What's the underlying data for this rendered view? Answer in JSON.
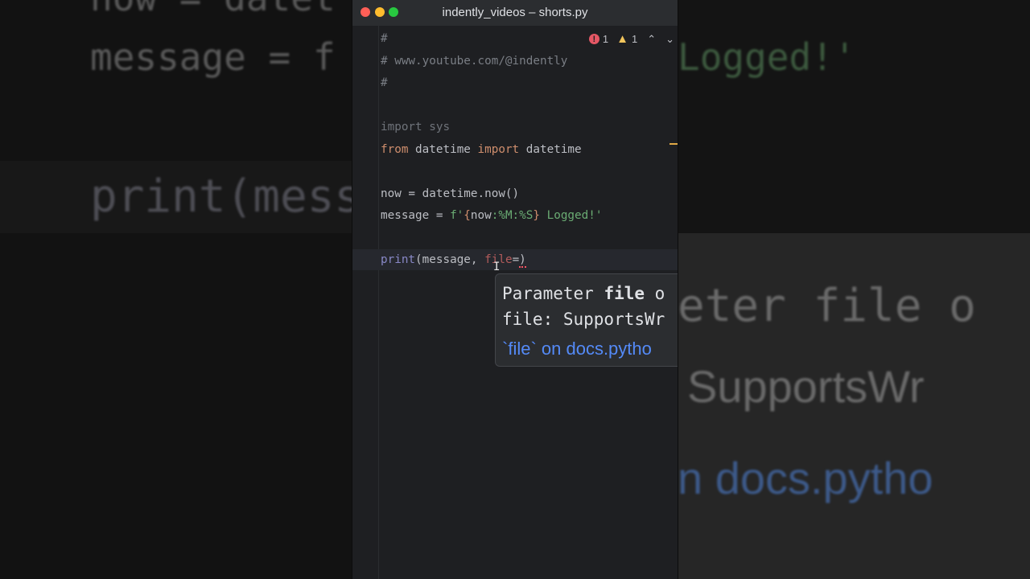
{
  "window": {
    "title": "indently_videos – shorts.py"
  },
  "inspections": {
    "errors": "1",
    "warnings": "1"
  },
  "code": {
    "l1": "#",
    "l2": "# www.youtube.com/@indently",
    "l3": "#",
    "l5_kw": "import",
    "l5_mod": " sys",
    "l6_from": "from",
    "l6_mod": " datetime ",
    "l6_import": "import",
    "l6_name": " datetime",
    "l8": "now = datetime.now()",
    "l9_pre": "message = ",
    "l9_f": "f'",
    "l9_brace_open": "{",
    "l9_now": "now",
    "l9_fmt": ":%M:%S",
    "l9_brace_close": "}",
    "l9_str": " Logged!'",
    "l11_print": "print",
    "l11_args": "(message, ",
    "l11_param": "file",
    "l11_eq": "=",
    "l11_close": ")"
  },
  "popup": {
    "prefix": "Parameter ",
    "param": "file",
    "suffix": " o",
    "type_line": "file: SupportsWr",
    "link": "`file` on docs.pytho"
  },
  "background": {
    "left_line1": "now = datet",
    "left_line2": "message = f",
    "left_line3": "print(messa",
    "right_line1": "Logged!'",
    "right_line2": "eter file o",
    "right_line3": "SupportsWr",
    "right_line4": "n docs.pytho"
  }
}
